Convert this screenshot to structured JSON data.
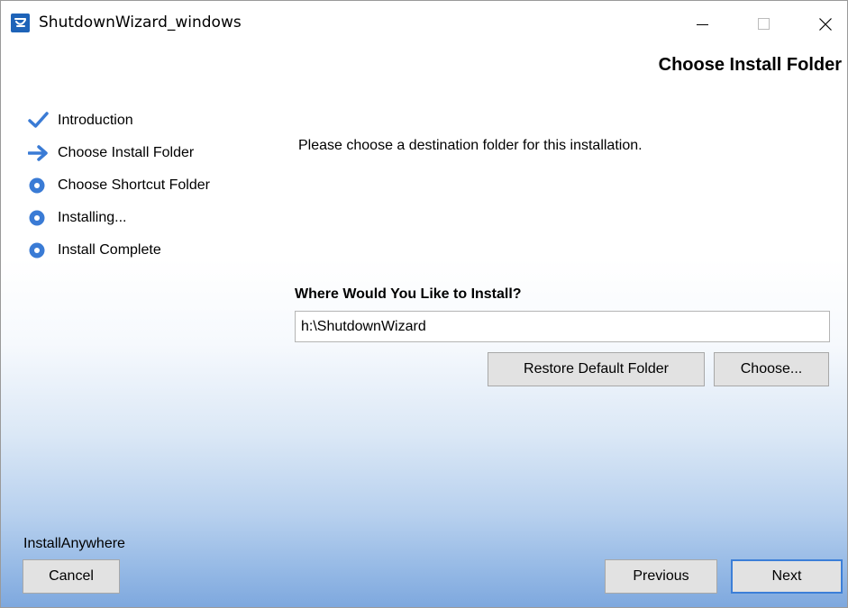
{
  "window": {
    "title": "ShutdownWizard_windows",
    "icons": {
      "app": "installer-app-icon",
      "minimize": "minimize-icon",
      "maximize": "maximize-icon",
      "close": "close-icon"
    }
  },
  "page": {
    "heading": "Choose Install Folder"
  },
  "steps": [
    {
      "label": "Introduction",
      "status": "completed",
      "icon": "checkmark-icon"
    },
    {
      "label": "Choose Install Folder",
      "status": "current",
      "icon": "arrow-right-icon"
    },
    {
      "label": "Choose Shortcut Folder",
      "status": "pending",
      "icon": "bullet-icon"
    },
    {
      "label": "Installing...",
      "status": "pending",
      "icon": "bullet-icon"
    },
    {
      "label": "Install Complete",
      "status": "pending",
      "icon": "bullet-icon"
    }
  ],
  "content": {
    "instruction": "Please choose a destination folder for this installation.",
    "install_label": "Where Would You Like to Install?",
    "install_path": "h:\\ShutdownWizard",
    "restore_button": "Restore Default Folder",
    "choose_button": "Choose..."
  },
  "footer": {
    "brand": "InstallAnywhere",
    "cancel_button": "Cancel",
    "previous_button": "Previous",
    "next_button": "Next"
  },
  "colors": {
    "accent": "#3a7bd5",
    "gradient_bottom": "#7ea8de",
    "button_face": "#e2e2e2"
  }
}
